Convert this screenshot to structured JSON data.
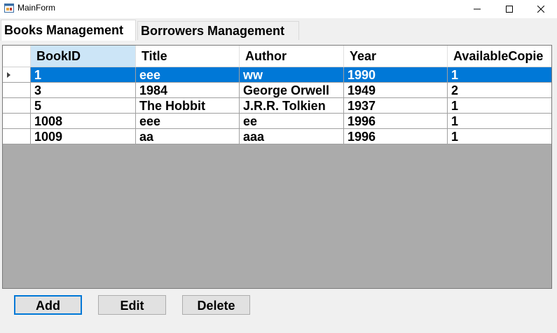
{
  "window": {
    "title": "MainForm"
  },
  "tabs": [
    {
      "label": "Books Management",
      "selected": true
    },
    {
      "label": "Borrowers Management",
      "selected": false
    }
  ],
  "grid": {
    "columns": [
      "BookID",
      "Title",
      "Author",
      "Year",
      "AvailableCopie"
    ],
    "rows": [
      [
        "1",
        "eee",
        "ww",
        "1990",
        "1"
      ],
      [
        "3",
        "1984",
        "George Orwell",
        "1949",
        "2"
      ],
      [
        "5",
        "The Hobbit",
        "J.R.R. Tolkien",
        "1937",
        "1"
      ],
      [
        "1008",
        "eee",
        "ee",
        "1996",
        "1"
      ],
      [
        "1009",
        "aa",
        "aaa",
        "1996",
        "1"
      ]
    ],
    "selected_row": 0
  },
  "buttons": {
    "add": "Add",
    "edit": "Edit",
    "delete": "Delete"
  },
  "colors": {
    "selection": "#0078d7",
    "grid_background": "#ababab",
    "header_selected": "#cce5f7"
  }
}
